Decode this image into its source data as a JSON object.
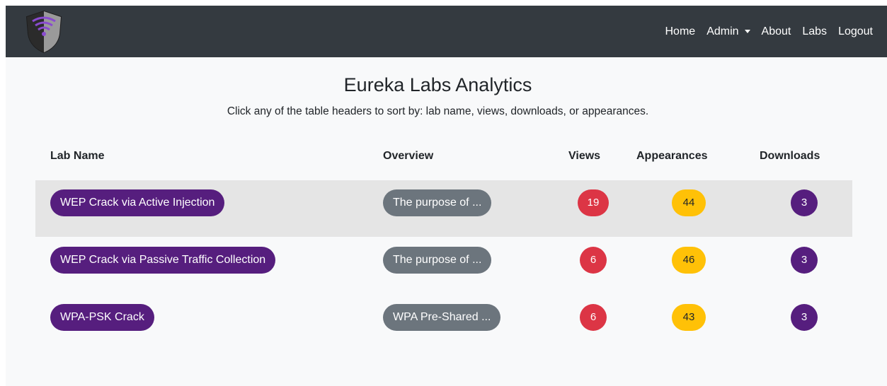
{
  "nav": {
    "links": [
      "Home",
      "Admin",
      "About",
      "Labs",
      "Logout"
    ]
  },
  "page": {
    "title": "Eureka Labs Analytics",
    "subtitle": "Click any of the table headers to sort by: lab name, views, downloads, or appearances."
  },
  "table": {
    "headers": [
      "Lab Name",
      "Overview",
      "Views",
      "Appearances",
      "Downloads"
    ],
    "rows": [
      {
        "lab": "WEP Crack via Active Injection",
        "overview": "The purpose of ...",
        "views": "19",
        "appearances": "44",
        "downloads": "3"
      },
      {
        "lab": "WEP Crack via Passive Traffic Collection",
        "overview": "The purpose of ...",
        "views": "6",
        "appearances": "46",
        "downloads": "3"
      },
      {
        "lab": "WPA-PSK Crack",
        "overview": "WPA Pre-Shared ...",
        "views": "6",
        "appearances": "43",
        "downloads": "3"
      }
    ]
  },
  "colors": {
    "navbar": "#343a40",
    "lab_pill": "#561e7e",
    "overview_pill": "#6c757d",
    "views_badge": "#dc3545",
    "appearances_badge": "#ffc107",
    "downloads_badge": "#561e7e"
  }
}
